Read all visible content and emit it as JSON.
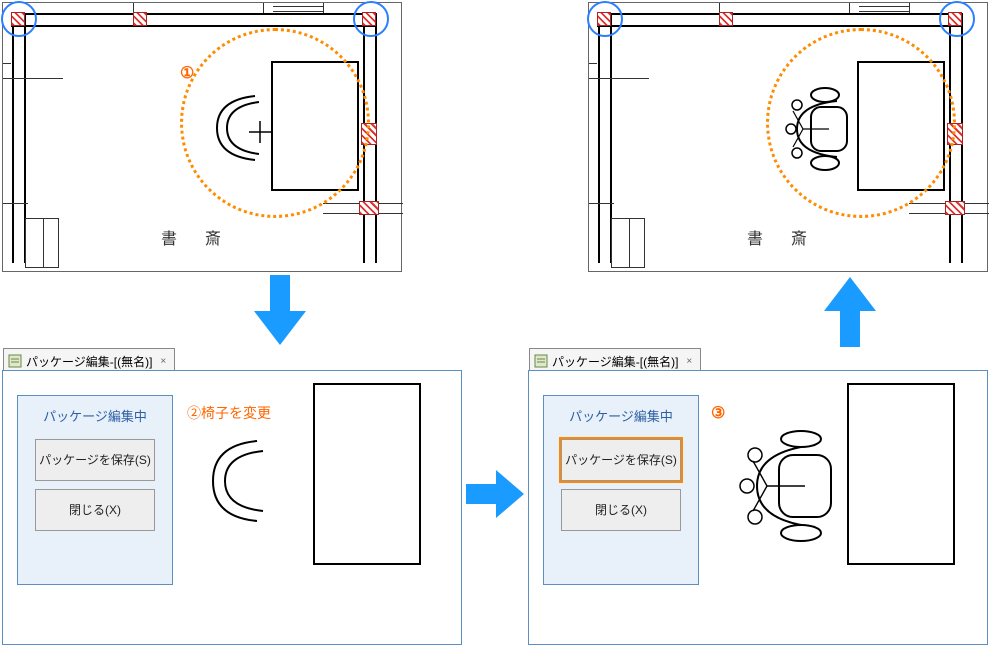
{
  "plan": {
    "room_label": "書　斎",
    "step1_label": "①",
    "step2_label": "②椅子を変更",
    "step3_label": "③"
  },
  "editor": {
    "tab_title": "パッケージ編集-[(無名)]",
    "box_title": "パッケージ編集中",
    "save_button": "パッケージを保存(S)",
    "close_button": "閉じる(X)"
  }
}
